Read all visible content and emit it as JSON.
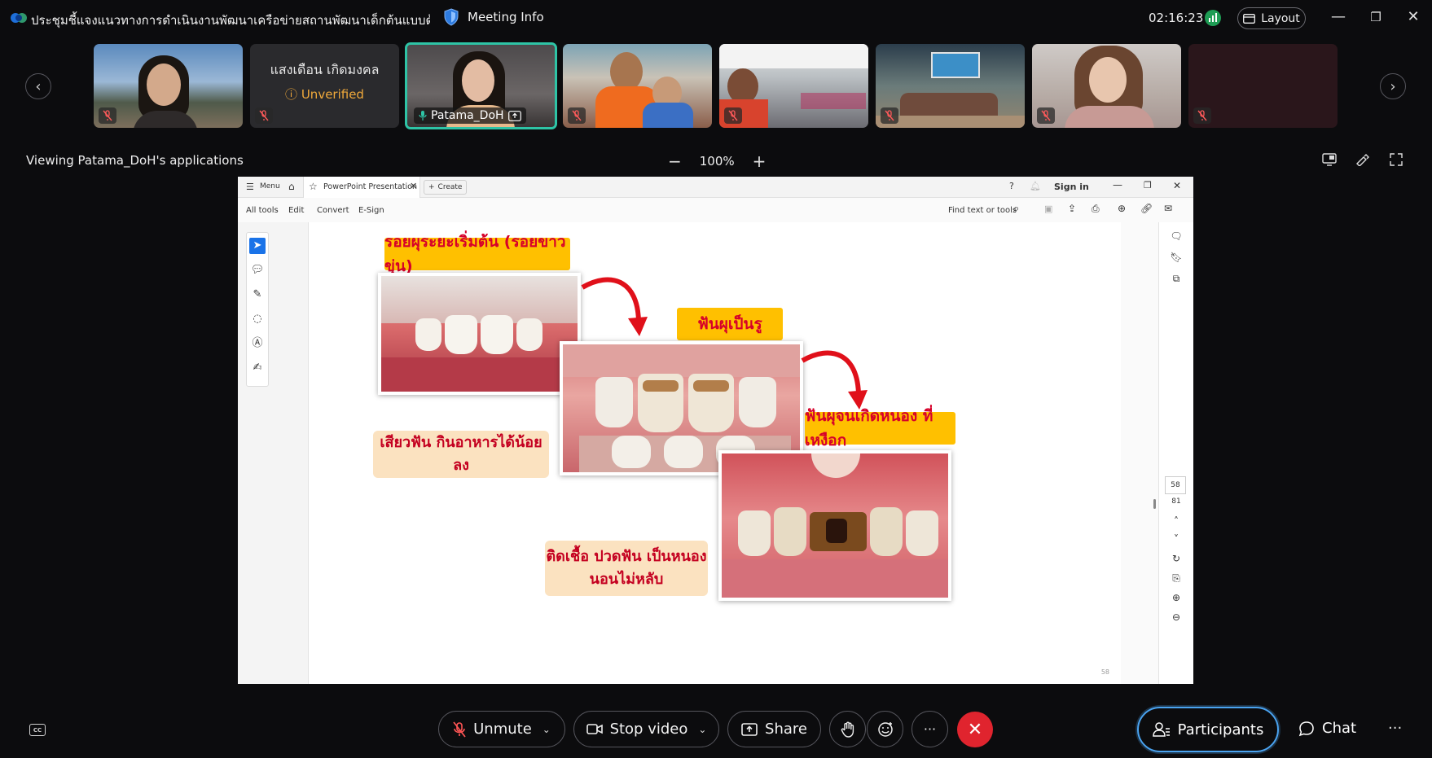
{
  "topbar": {
    "meeting_title": "ประชุมชี้แจงแนวทางการดำเนินงานพัฒนาเครือข่ายสถานพัฒนาเด็กต้นแบบด้านสุข...",
    "meeting_info_label": "Meeting Info",
    "timer": "02:16:23",
    "layout_label": "Layout"
  },
  "participants_strip": {
    "tiles": [
      {
        "kind": "video",
        "muted": true
      },
      {
        "kind": "text",
        "name": "แสงเดือน  เกิดมงคล",
        "status": "Unverified",
        "muted": true
      },
      {
        "kind": "video",
        "name": "Patama_DoH",
        "active": true,
        "sharing": true
      },
      {
        "kind": "video",
        "muted": true
      },
      {
        "kind": "video",
        "muted": true
      },
      {
        "kind": "video",
        "muted": true
      },
      {
        "kind": "video",
        "muted": true
      },
      {
        "kind": "video",
        "muted": true
      }
    ]
  },
  "viewer": {
    "viewing_label": "Viewing Patama_DoH's applications",
    "zoom_minus": "−",
    "zoom_level": "100%",
    "zoom_plus": "+"
  },
  "pdf": {
    "tabs": {
      "menu": "Menu",
      "doc_tab": "PowerPoint Presentation",
      "create": "Create",
      "sign_in": "Sign in"
    },
    "toolbar": {
      "items": [
        "All tools",
        "Edit",
        "Convert",
        "E-Sign"
      ],
      "find": "Find text or tools"
    },
    "page_current": "58",
    "page_total": "81"
  },
  "slide": {
    "label_1": "รอยผุระยะเริ่มต้น (รอยขาวขุ่น)",
    "label_2": "ฟันผุเป็นรู",
    "label_3": "ฟันผุจนเกิดหนอง ที่เหงือก",
    "note_1": "เสียวฟัน กินอาหารได้น้อยลง",
    "note_2_line1": "ติดเชื้อ ปวดฟัน เป็นหนอง",
    "note_2_line2": "นอนไม่หลับ",
    "page_number": "58"
  },
  "controls": {
    "unmute": "Unmute",
    "stop_video": "Stop video",
    "share": "Share",
    "participants": "Participants",
    "chat": "Chat",
    "more": "···"
  },
  "colors": {
    "accent_active": "#2ec4a6",
    "end_call": "#e0242e",
    "participants_border": "#4aa3f0",
    "unverified": "#f0a93b",
    "slide_label_bg": "#ffc000",
    "slide_label_text": "#d6002a"
  }
}
